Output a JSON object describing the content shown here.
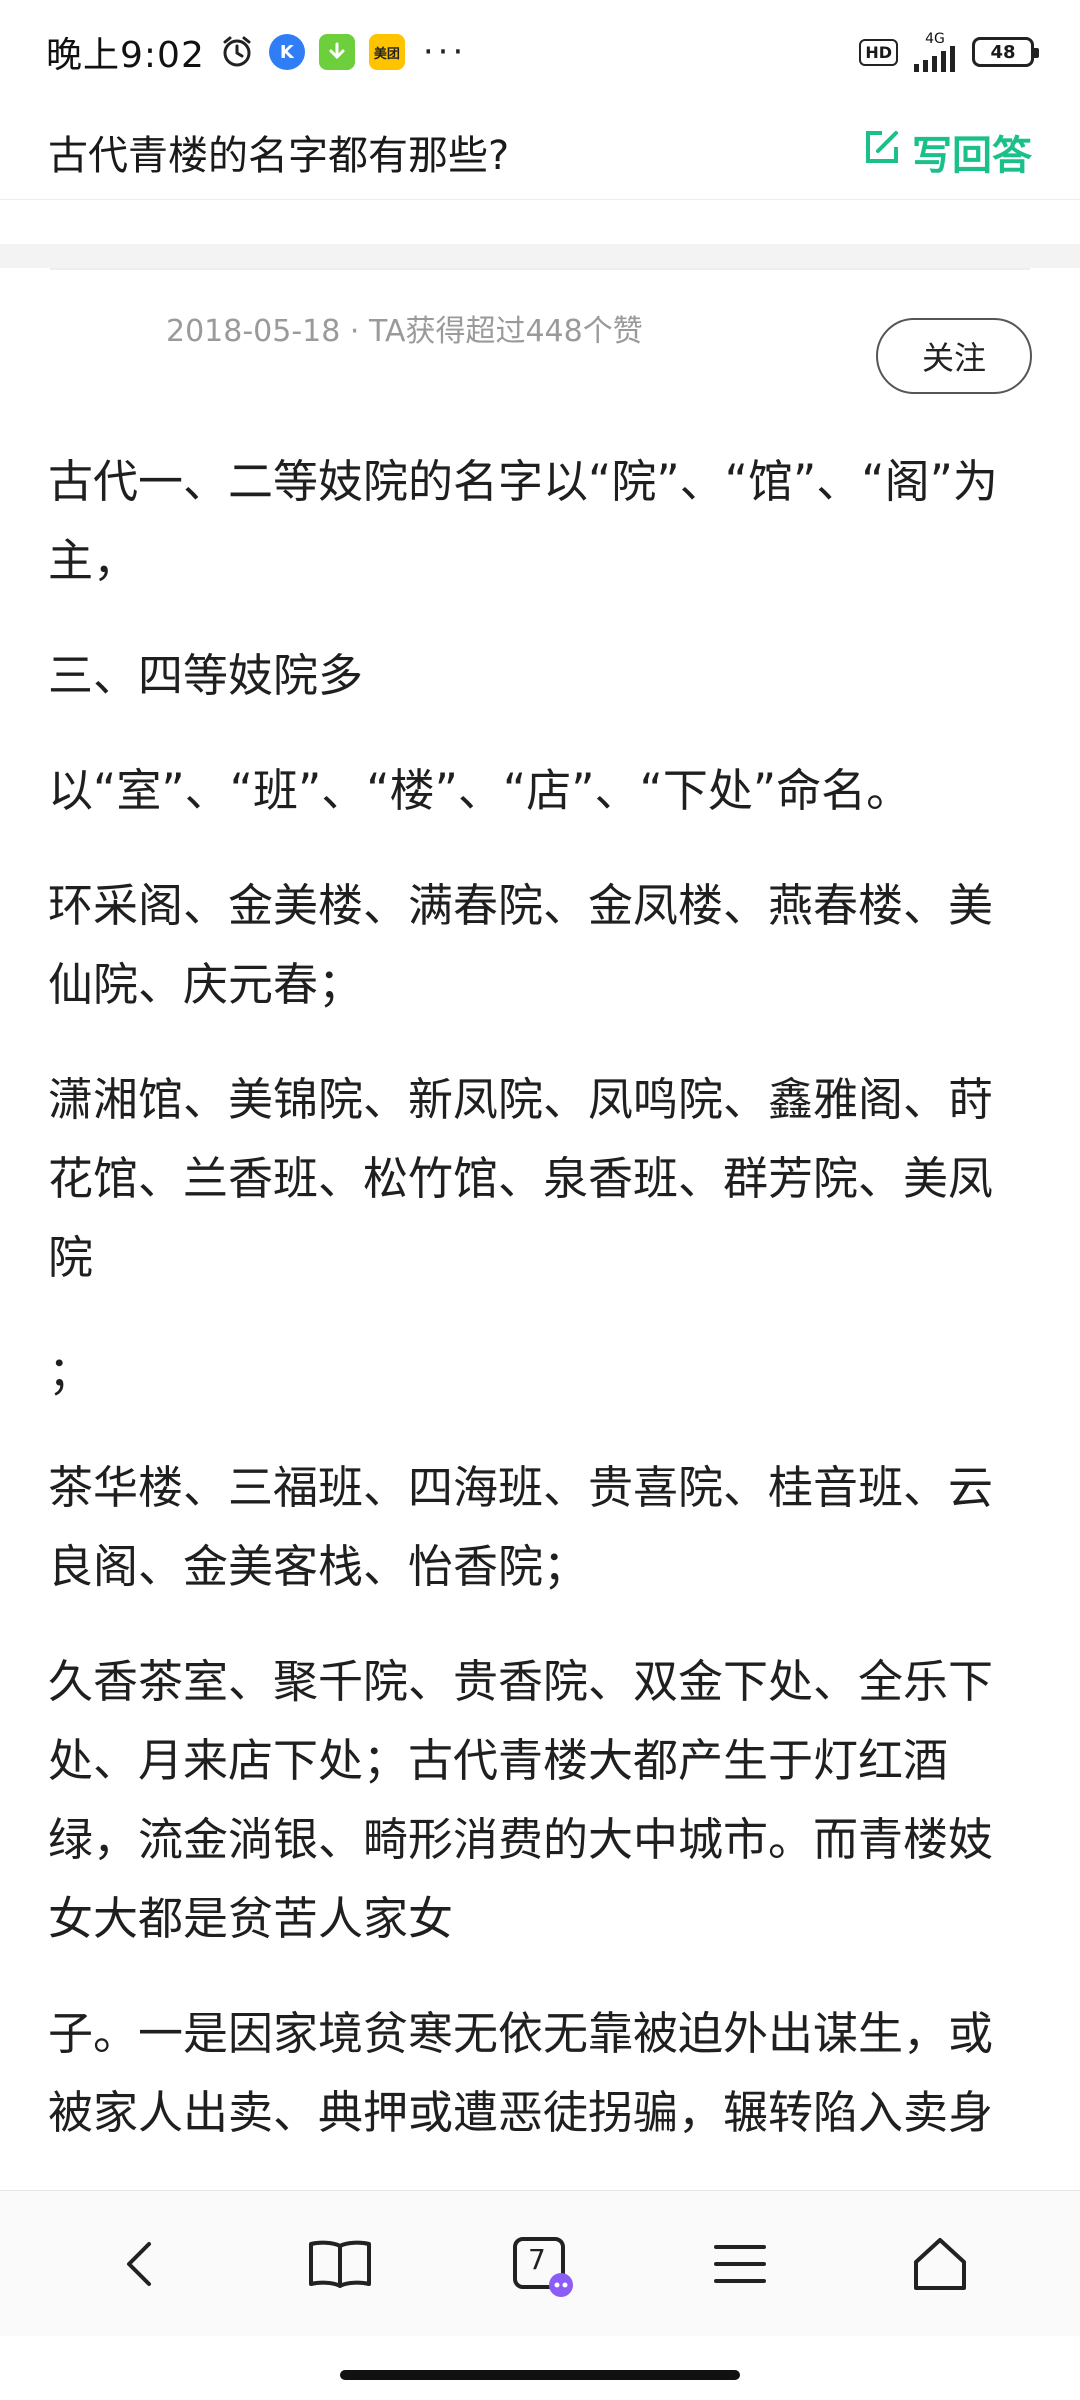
{
  "status_bar": {
    "time": "晚上9:02",
    "app_icons": [
      {
        "name": "alarm-icon"
      },
      {
        "name": "k-app-icon",
        "text": "K",
        "color": "#2f7ef5"
      },
      {
        "name": "download-app-icon",
        "color": "#6ccf3b"
      },
      {
        "name": "meituan-app-icon",
        "text": "美团",
        "color": "#ffc300"
      }
    ],
    "more": "···",
    "hd": "HD",
    "network": "4G",
    "battery": "48"
  },
  "header": {
    "question_title": "古代青楼的名字都有那些?",
    "write_answer_label": "写回答",
    "accent_color": "#1bbf8a"
  },
  "answer": {
    "meta": "2018-05-18 · TA获得超过448个赞",
    "follow_label": "关注",
    "paragraphs": [
      "古代一、二等妓院的名字以“院”、“馆”、“阁”为主，",
      "三、四等妓院多",
      "以“室”、“班”、“楼”、“店”、“下处”命名。",
      "环采阁、金美楼、满春院、金凤楼、燕春楼、美仙院、庆元春；",
      "潇湘馆、美锦院、新凤院、凤鸣院、鑫雅阁、莳花馆、兰香班、松竹馆、泉香班、群芳院、美凤院",
      "；",
      "茶华楼、三福班、四海班、贵喜院、桂音班、云良阁、金美客栈、怡香院；",
      "久香茶室、聚千院、贵香院、双金下处、全乐下处、月来店下处；古代青楼大都产生于灯红酒绿，流金淌银、畸形消费的大中城市。而青楼妓女大都是贫苦人家女",
      "子。一是因家境贫寒无依无靠被迫外出谋生，或被家人出卖、典押或遭恶徒拐骗，辗转陷入卖身之"
    ]
  },
  "bottom_nav": {
    "tab_count": "7",
    "items": [
      {
        "name": "back-icon"
      },
      {
        "name": "bookmarks-icon"
      },
      {
        "name": "tabs-icon"
      },
      {
        "name": "menu-icon"
      },
      {
        "name": "home-icon"
      }
    ]
  }
}
